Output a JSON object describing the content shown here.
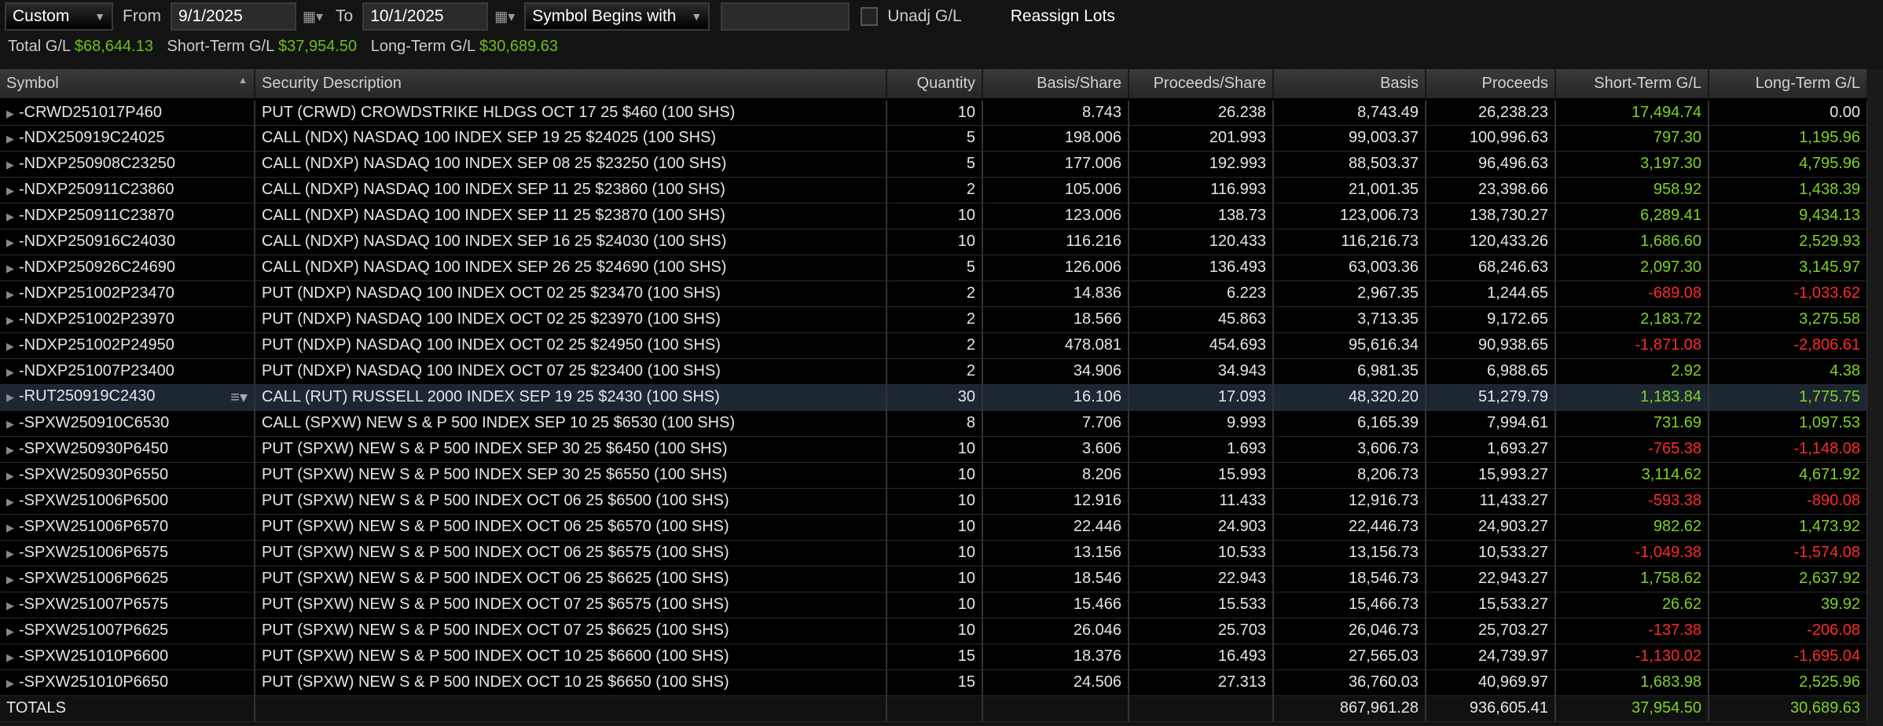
{
  "toolbar": {
    "range": "Custom",
    "from_label": "From",
    "from": "9/1/2025",
    "to_label": "To",
    "to": "10/1/2025",
    "filter": "Symbol Begins with",
    "filter_value": "",
    "unadj": "Unadj G/L",
    "reassign": "Reassign Lots"
  },
  "summary": {
    "total_label": "Total G/L",
    "total": "$68,644.13",
    "st_label": "Short-Term G/L",
    "st": "$37,954.50",
    "lt_label": "Long-Term G/L",
    "lt": "$30,689.63"
  },
  "columns": [
    "Symbol",
    "Security Description",
    "Quantity",
    "Basis/Share",
    "Proceeds/Share",
    "Basis",
    "Proceeds",
    "Short-Term G/L",
    "Long-Term G/L"
  ],
  "rows": [
    [
      "-CRWD251017P460",
      "PUT (CRWD) CROWDSTRIKE HLDGS OCT 17 25 $460 (100 SHS)",
      "10",
      "8.743",
      "26.238",
      "8,743.49",
      "26,238.23",
      "17,494.74",
      "0.00"
    ],
    [
      "-NDX250919C24025",
      "CALL (NDX) NASDAQ 100 INDEX SEP 19 25 $24025 (100 SHS)",
      "5",
      "198.006",
      "201.993",
      "99,003.37",
      "100,996.63",
      "797.30",
      "1,195.96"
    ],
    [
      "-NDXP250908C23250",
      "CALL (NDXP) NASDAQ 100 INDEX SEP 08 25 $23250 (100 SHS)",
      "5",
      "177.006",
      "192.993",
      "88,503.37",
      "96,496.63",
      "3,197.30",
      "4,795.96"
    ],
    [
      "-NDXP250911C23860",
      "CALL (NDXP) NASDAQ 100 INDEX SEP 11 25 $23860 (100 SHS)",
      "2",
      "105.006",
      "116.993",
      "21,001.35",
      "23,398.66",
      "958.92",
      "1,438.39"
    ],
    [
      "-NDXP250911C23870",
      "CALL (NDXP) NASDAQ 100 INDEX SEP 11 25 $23870 (100 SHS)",
      "10",
      "123.006",
      "138.73",
      "123,006.73",
      "138,730.27",
      "6,289.41",
      "9,434.13"
    ],
    [
      "-NDXP250916C24030",
      "CALL (NDXP) NASDAQ 100 INDEX SEP 16 25 $24030 (100 SHS)",
      "10",
      "116.216",
      "120.433",
      "116,216.73",
      "120,433.26",
      "1,686.60",
      "2,529.93"
    ],
    [
      "-NDXP250926C24690",
      "CALL (NDXP) NASDAQ 100 INDEX SEP 26 25 $24690 (100 SHS)",
      "5",
      "126.006",
      "136.493",
      "63,003.36",
      "68,246.63",
      "2,097.30",
      "3,145.97"
    ],
    [
      "-NDXP251002P23470",
      "PUT (NDXP) NASDAQ 100 INDEX OCT 02 25 $23470 (100 SHS)",
      "2",
      "14.836",
      "6.223",
      "2,967.35",
      "1,244.65",
      "-689.08",
      "-1,033.62"
    ],
    [
      "-NDXP251002P23970",
      "PUT (NDXP) NASDAQ 100 INDEX OCT 02 25 $23970 (100 SHS)",
      "2",
      "18.566",
      "45.863",
      "3,713.35",
      "9,172.65",
      "2,183.72",
      "3,275.58"
    ],
    [
      "-NDXP251002P24950",
      "PUT (NDXP) NASDAQ 100 INDEX OCT 02 25 $24950 (100 SHS)",
      "2",
      "478.081",
      "454.693",
      "95,616.34",
      "90,938.65",
      "-1,871.08",
      "-2,806.61"
    ],
    [
      "-NDXP251007P23400",
      "PUT (NDXP) NASDAQ 100 INDEX OCT 07 25 $23400 (100 SHS)",
      "2",
      "34.906",
      "34.943",
      "6,981.35",
      "6,988.65",
      "2.92",
      "4.38"
    ],
    [
      "-RUT250919C2430",
      "CALL (RUT) RUSSELL 2000 INDEX SEP 19 25 $2430 (100 SHS)",
      "30",
      "16.106",
      "17.093",
      "48,320.20",
      "51,279.79",
      "1,183.84",
      "1,775.75"
    ],
    [
      "-SPXW250910C6530",
      "CALL (SPXW) NEW S & P 500 INDEX SEP 10 25 $6530 (100 SHS)",
      "8",
      "7.706",
      "9.993",
      "6,165.39",
      "7,994.61",
      "731.69",
      "1,097.53"
    ],
    [
      "-SPXW250930P6450",
      "PUT (SPXW) NEW S & P 500 INDEX SEP 30 25 $6450 (100 SHS)",
      "10",
      "3.606",
      "1.693",
      "3,606.73",
      "1,693.27",
      "-765.38",
      "-1,148.08"
    ],
    [
      "-SPXW250930P6550",
      "PUT (SPXW) NEW S & P 500 INDEX SEP 30 25 $6550 (100 SHS)",
      "10",
      "8.206",
      "15.993",
      "8,206.73",
      "15,993.27",
      "3,114.62",
      "4,671.92"
    ],
    [
      "-SPXW251006P6500",
      "PUT (SPXW) NEW S & P 500 INDEX OCT 06 25 $6500 (100 SHS)",
      "10",
      "12.916",
      "11.433",
      "12,916.73",
      "11,433.27",
      "-593.38",
      "-890.08"
    ],
    [
      "-SPXW251006P6570",
      "PUT (SPXW) NEW S & P 500 INDEX OCT 06 25 $6570 (100 SHS)",
      "10",
      "22.446",
      "24.903",
      "22,446.73",
      "24,903.27",
      "982.62",
      "1,473.92"
    ],
    [
      "-SPXW251006P6575",
      "PUT (SPXW) NEW S & P 500 INDEX OCT 06 25 $6575 (100 SHS)",
      "10",
      "13.156",
      "10.533",
      "13,156.73",
      "10,533.27",
      "-1,049.38",
      "-1,574.08"
    ],
    [
      "-SPXW251006P6625",
      "PUT (SPXW) NEW S & P 500 INDEX OCT 06 25 $6625 (100 SHS)",
      "10",
      "18.546",
      "22.943",
      "18,546.73",
      "22,943.27",
      "1,758.62",
      "2,637.92"
    ],
    [
      "-SPXW251007P6575",
      "PUT (SPXW) NEW S & P 500 INDEX OCT 07 25 $6575 (100 SHS)",
      "10",
      "15.466",
      "15.533",
      "15,466.73",
      "15,533.27",
      "26.62",
      "39.92"
    ],
    [
      "-SPXW251007P6625",
      "PUT (SPXW) NEW S & P 500 INDEX OCT 07 25 $6625 (100 SHS)",
      "10",
      "26.046",
      "25.703",
      "26,046.73",
      "25,703.27",
      "-137.38",
      "-206.08"
    ],
    [
      "-SPXW251010P6600",
      "PUT (SPXW) NEW S & P 500 INDEX OCT 10 25 $6600 (100 SHS)",
      "15",
      "18.376",
      "16.493",
      "27,565.03",
      "24,739.97",
      "-1,130.02",
      "-1,695.04"
    ],
    [
      "-SPXW251010P6650",
      "PUT (SPXW) NEW S & P 500 INDEX OCT 10 25 $6650 (100 SHS)",
      "15",
      "24.506",
      "27.313",
      "36,760.03",
      "40,969.97",
      "1,683.98",
      "2,525.96"
    ]
  ],
  "totals": {
    "label": "TOTALS",
    "basis": "867,961.28",
    "proceeds": "936,605.41",
    "st": "37,954.50",
    "lt": "30,689.63"
  },
  "colors": {
    "gain": "#7ed321",
    "loss": "#ff2a2a"
  }
}
